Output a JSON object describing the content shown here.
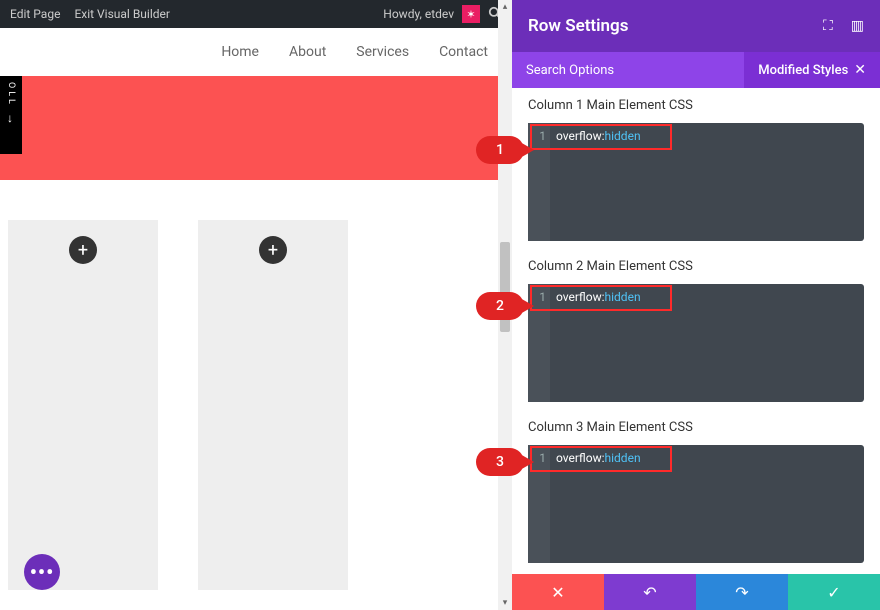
{
  "admin_bar": {
    "edit_page": "Edit Page",
    "exit_vb": "Exit Visual Builder",
    "howdy": "Howdy, etdev"
  },
  "nav": {
    "home": "Home",
    "about": "About",
    "services": "Services",
    "contact": "Contact"
  },
  "scroll_tab": {
    "label": "OLL",
    "arrow": "↓"
  },
  "panel": {
    "title": "Row Settings",
    "tab_search": "Search Options",
    "tab_modified": "Modified Styles"
  },
  "fields": [
    {
      "label": "Column 1 Main Element CSS",
      "line_no": "1",
      "kw": "overflow:",
      "val": "hidden"
    },
    {
      "label": "Column 2 Main Element CSS",
      "line_no": "1",
      "kw": "overflow:",
      "val": "hidden"
    },
    {
      "label": "Column 3 Main Element CSS",
      "line_no": "1",
      "kw": "overflow:",
      "val": "hidden"
    }
  ],
  "callouts": [
    "1",
    "2",
    "3"
  ],
  "icons": {
    "plus": "+",
    "star": "✶",
    "search": "🔍",
    "fab": "•••",
    "expand": "⛶",
    "cols": "▥",
    "close": "✕",
    "undo": "↶",
    "redo": "↷",
    "check": "✓"
  }
}
